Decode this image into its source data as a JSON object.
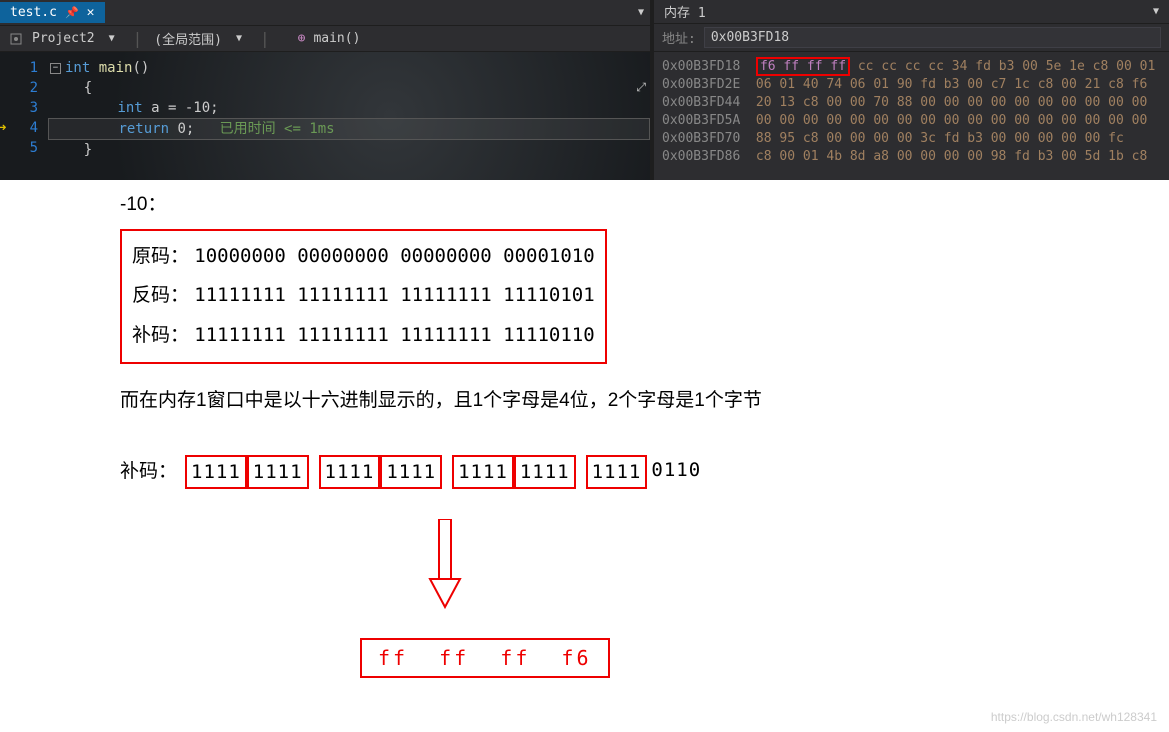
{
  "tab": {
    "filename": "test.c",
    "pin_glyph": "📌",
    "close_glyph": "✕"
  },
  "toolbar": {
    "project": "Project2",
    "scope": "(全局范围)",
    "function": "main()"
  },
  "code": {
    "line_numbers": [
      "1",
      "2",
      "3",
      "4",
      "5"
    ],
    "line1_kw1": "int",
    "line1_fn": "main",
    "line1_parens": "()",
    "line2": "{",
    "line3_kw": "int",
    "line3_rest": " a = -10;",
    "line4_kw": "return",
    "line4_rest": " 0;",
    "line4_comment": "   已用时间 <= 1ms",
    "line5": "}"
  },
  "memory": {
    "title": "内存 1",
    "addr_label": "地址:",
    "addr_value": "0x00B3FD18",
    "rows": [
      {
        "addr": "0x00B3FD18",
        "highlighted": "f6 ff ff ff",
        "rest": " cc cc cc cc 34 fd b3 00 5e 1e c8 00 01"
      },
      {
        "addr": "0x00B3FD2E",
        "bytes": "  06 01 40 74 06 01 90 fd b3 00 c7 1c c8 00 21 c8 f6"
      },
      {
        "addr": "0x00B3FD44",
        "bytes": "  20 13 c8 00 00 70 88 00 00 00 00 00 00 00 00 00 00"
      },
      {
        "addr": "0x00B3FD5A",
        "bytes": "  00 00 00 00 00 00 00 00 00 00 00 00 00 00 00 00 00"
      },
      {
        "addr": "0x00B3FD70",
        "bytes": "  88 95 c8 00 00 00 00 3c fd b3 00 00 00 00 00 fc"
      },
      {
        "addr": "0x00B3FD86",
        "bytes": "  c8 00 01 4b 8d a8 00 00 00 00 98 fd b3 00 5d 1b c8"
      }
    ]
  },
  "explain": {
    "number_label": "-10：",
    "original_label": "原码：",
    "original_bits": "10000000 00000000 00000000 00001010",
    "inverse_label": "反码：",
    "inverse_bits": "11111111 11111111 11111111 11110101",
    "complement_label": "补码：",
    "complement_bits": "11111111 11111111 11111111 11110110",
    "hex_note": "而在内存1窗口中是以十六进制显示的，且1个字母是4位，2个字母是1个字节",
    "nibble_label": "补码：",
    "nibbles": [
      [
        "1111",
        "1111"
      ],
      [
        "1111",
        "1111"
      ],
      [
        "1111",
        "1111"
      ],
      [
        "1111",
        "0110"
      ]
    ],
    "hex_bytes": [
      "ff",
      "ff",
      "ff",
      "f6"
    ]
  },
  "watermark": "https://blog.csdn.net/wh128341"
}
